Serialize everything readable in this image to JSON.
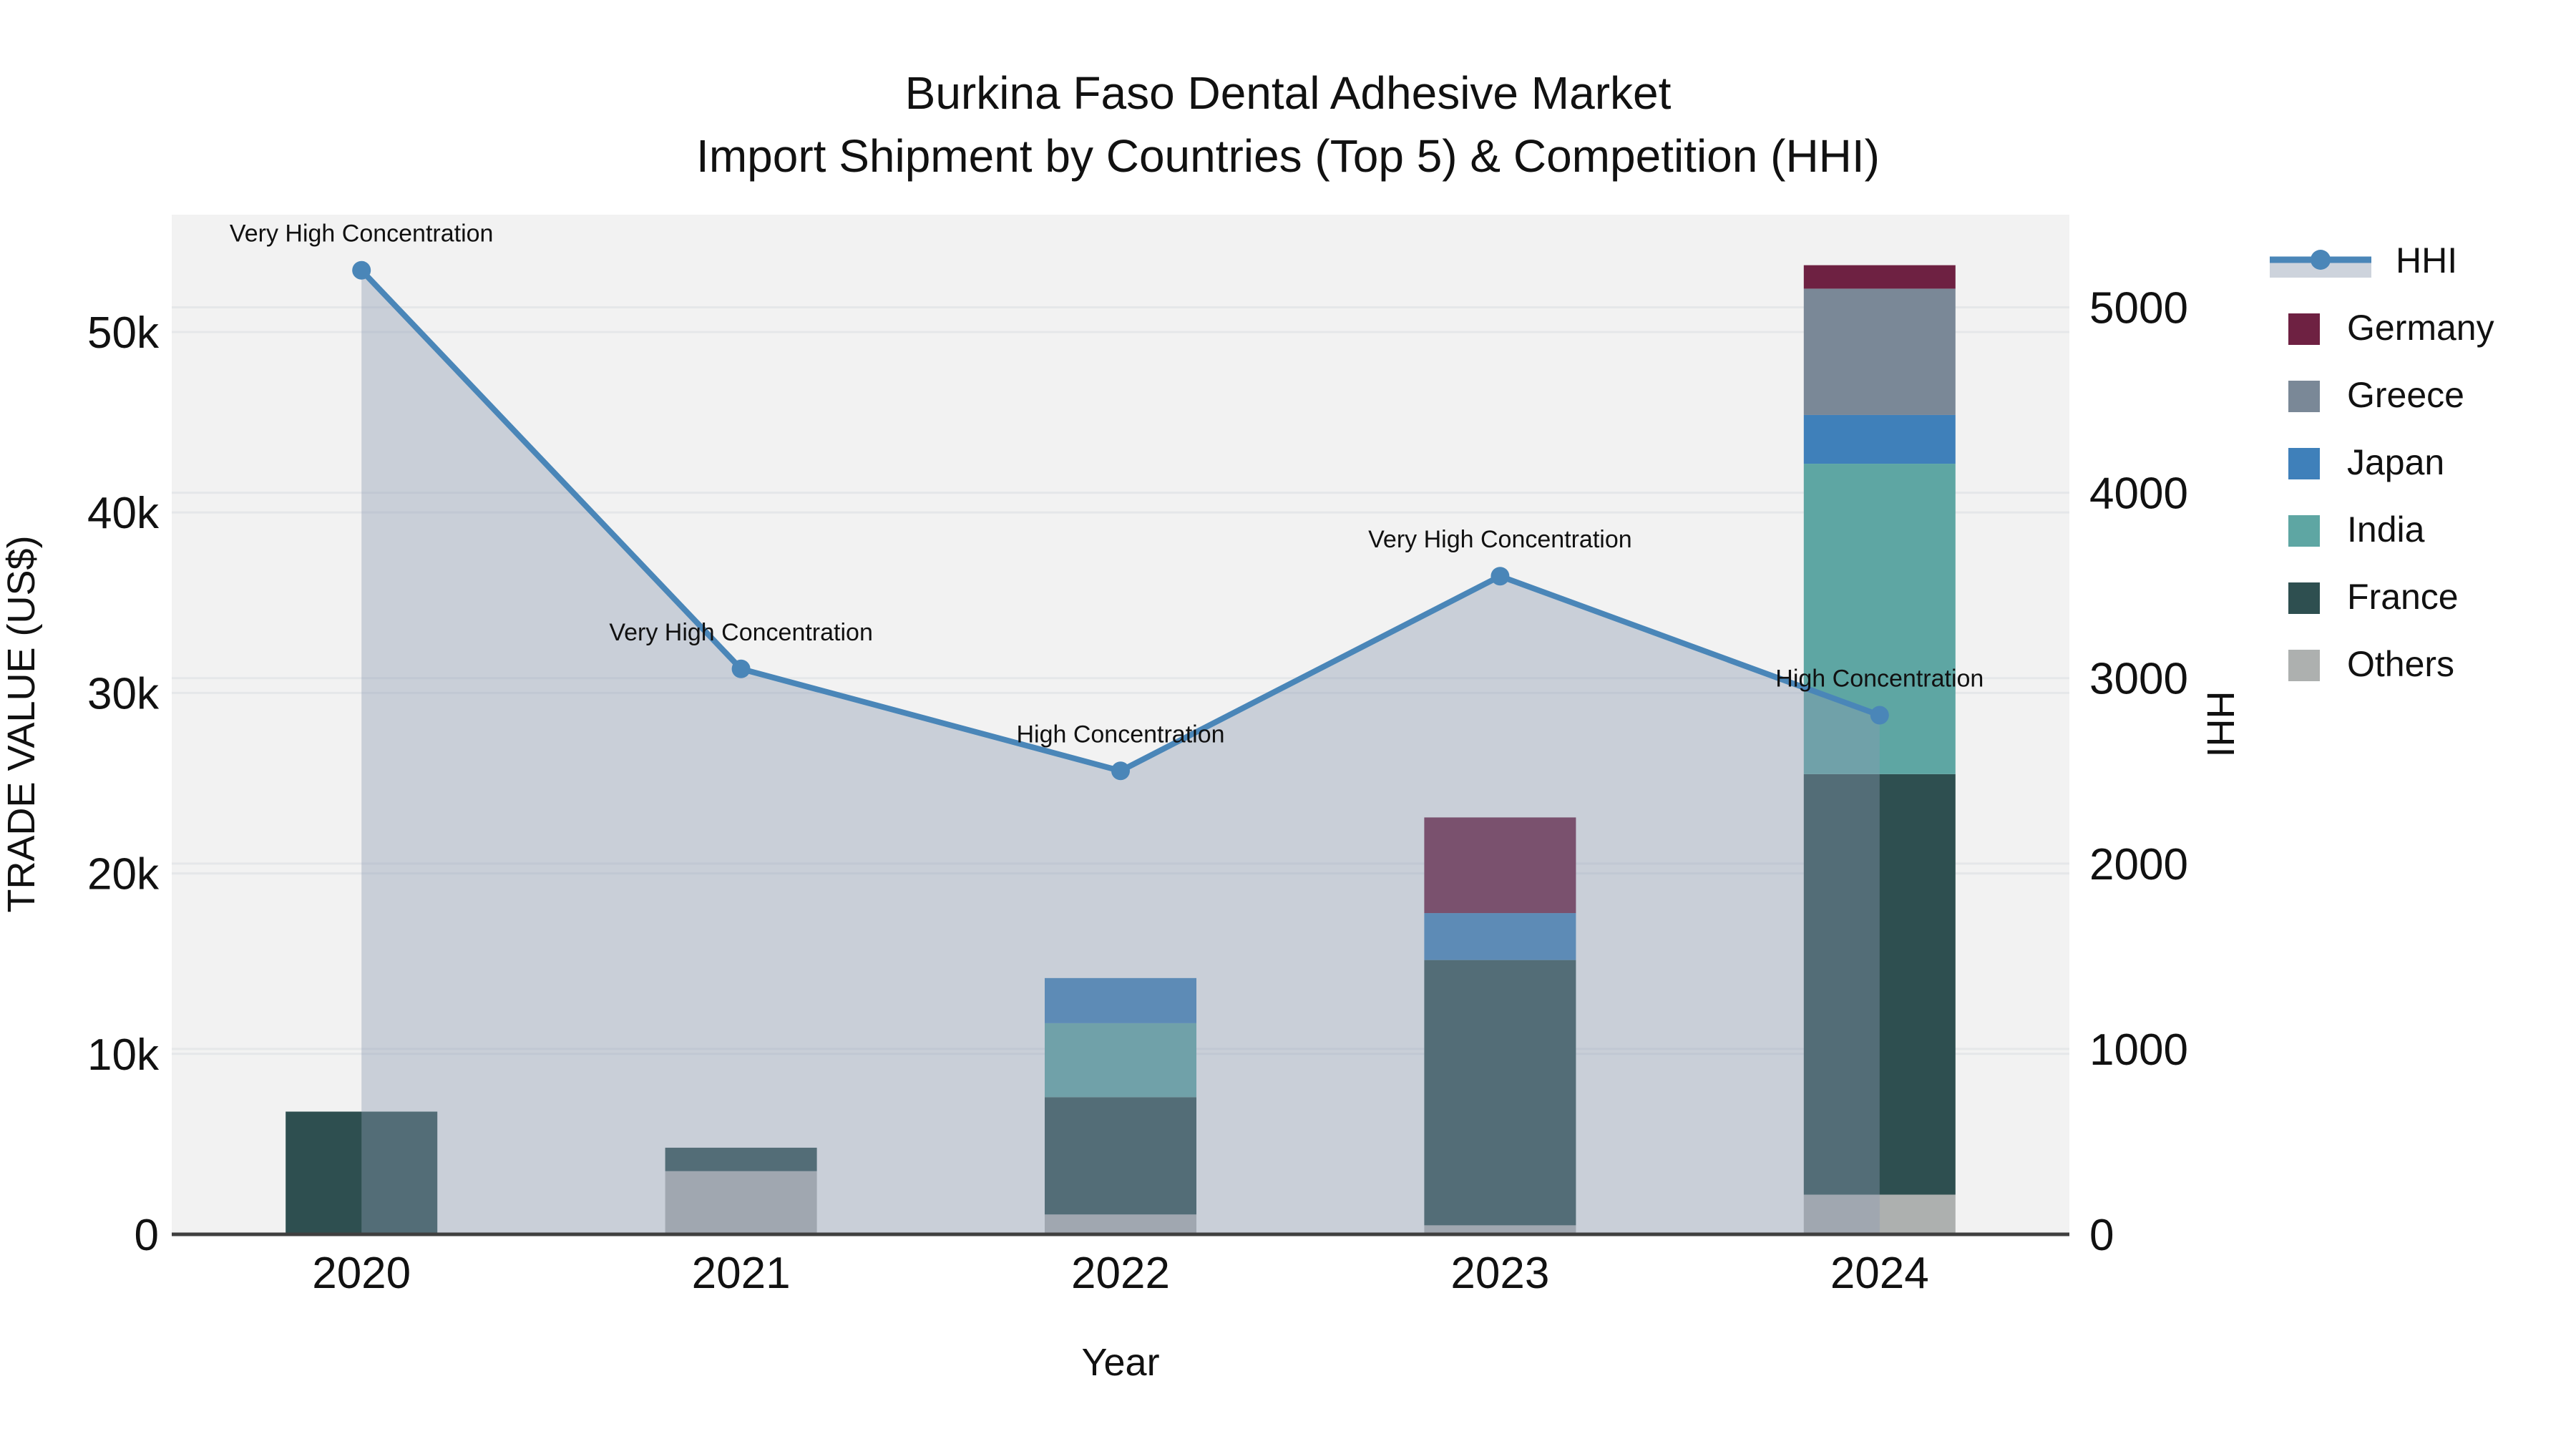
{
  "page": {
    "background": "#ffffff"
  },
  "chart_data": {
    "type": "combo-stacked-bar-line",
    "title": "Burkina Faso Dental Adhesive Market",
    "subtitle": "Import Shipment by Countries (Top 5) & Competition (HHI)",
    "xlabel": "Year",
    "ylabel_left": "TRADE VALUE (US$)",
    "ylabel_right": "HHI",
    "categories": [
      "2020",
      "2021",
      "2022",
      "2023",
      "2024"
    ],
    "bar_series_bottom_to_top": [
      {
        "name": "Others",
        "color": "#adb0af",
        "values": [
          0,
          3500,
          1100,
          500,
          2200
        ]
      },
      {
        "name": "France",
        "color": "#2e4f50",
        "values": [
          6800,
          1300,
          6500,
          14700,
          23300
        ]
      },
      {
        "name": "India",
        "color": "#5ea6a3",
        "values": [
          0,
          0,
          4100,
          0,
          17200
        ]
      },
      {
        "name": "Japan",
        "color": "#3f80ba",
        "values": [
          0,
          0,
          2500,
          2600,
          2700
        ]
      },
      {
        "name": "Greece",
        "color": "#7a8897",
        "values": [
          0,
          0,
          0,
          0,
          7000
        ]
      },
      {
        "name": "Germany",
        "color": "#6e2142",
        "values": [
          0,
          0,
          0,
          5300,
          1300
        ]
      }
    ],
    "line_series": {
      "name": "HHI",
      "values": [
        5200,
        3050,
        2500,
        3550,
        2800
      ],
      "color": "#4a86b8",
      "area_fill": "rgba(140,155,178,0.40)"
    },
    "point_annotations": [
      "Very High Concentration",
      "Very High Concentration",
      "High Concentration",
      "Very High Concentration",
      "High Concentration"
    ],
    "axes": {
      "left": {
        "min": 0,
        "max": 56500,
        "ticks": [
          0,
          10000,
          20000,
          30000,
          40000,
          50000
        ],
        "tick_labels": [
          "0",
          "10k",
          "20k",
          "30k",
          "40k",
          "50k"
        ]
      },
      "right": {
        "min": 0,
        "max": 5500,
        "ticks": [
          0,
          1000,
          2000,
          3000,
          4000,
          5000
        ],
        "tick_labels": [
          "0",
          "1000",
          "2000",
          "3000",
          "4000",
          "5000"
        ]
      }
    },
    "legend": {
      "position": "right",
      "items": [
        {
          "label": "HHI",
          "type": "line",
          "color": "#4a86b8",
          "band_color": "#cdd3dc"
        },
        {
          "label": "Germany",
          "type": "swatch",
          "color": "#6e2142"
        },
        {
          "label": "Greece",
          "type": "swatch",
          "color": "#7a8897"
        },
        {
          "label": "Japan",
          "type": "swatch",
          "color": "#3f80ba"
        },
        {
          "label": "India",
          "type": "swatch",
          "color": "#5ea6a3"
        },
        {
          "label": "France",
          "type": "swatch",
          "color": "#2e4f50"
        },
        {
          "label": "Others",
          "type": "swatch",
          "color": "#adb0af"
        }
      ]
    },
    "style": {
      "plot_bg": "#f2f2f2",
      "grid_color": "#e5e7e9",
      "axis_line_color": "#3f3f3f",
      "text_color": "#111111"
    },
    "layout_hints": {
      "grid": "on",
      "legend_position": "right-outside",
      "area_fill_under_line": true
    }
  }
}
